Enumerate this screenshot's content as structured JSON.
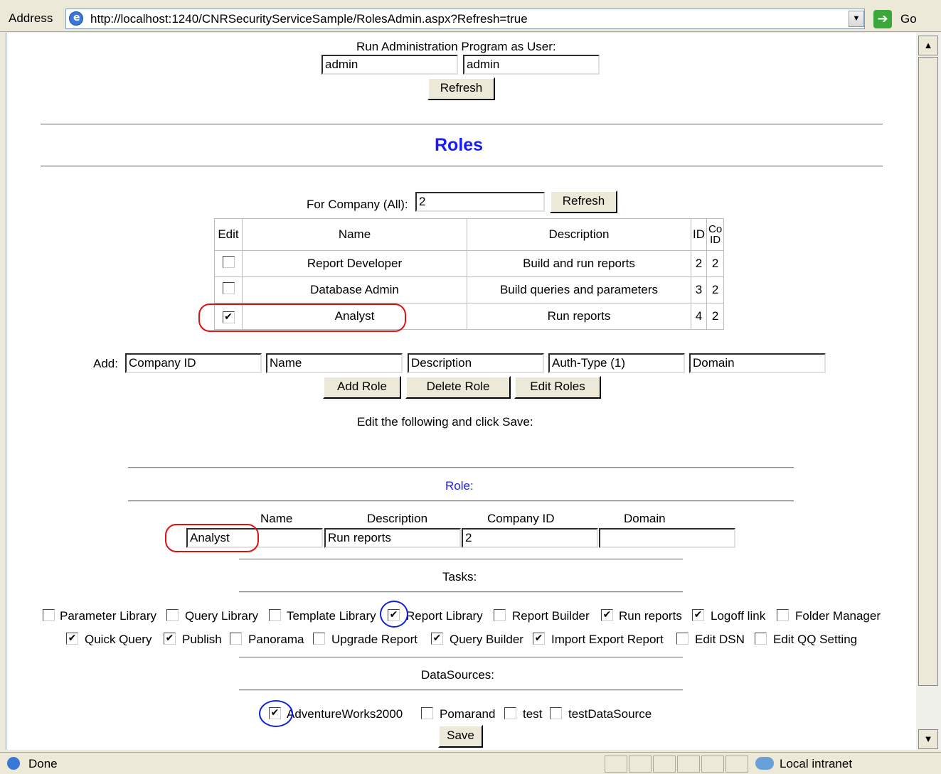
{
  "address_bar": {
    "label": "Address",
    "url": "http://localhost:1240/CNRSecurityServiceSample/RolesAdmin.aspx?Refresh=true",
    "go_label": "Go"
  },
  "run_as": {
    "title": "Run Administration Program as User:",
    "user1": "admin",
    "user2": "admin",
    "refresh_label": "Refresh"
  },
  "roles_heading": "Roles",
  "company_filter": {
    "label": "For Company (All):",
    "value": "2",
    "refresh_label": "Refresh"
  },
  "roles_table": {
    "headers": {
      "edit": "Edit",
      "name": "Name",
      "description": "Description",
      "id": "ID",
      "coid": "Co ID"
    },
    "rows": [
      {
        "checked": false,
        "name": "Report Developer",
        "description": "Build and run reports",
        "id": "2",
        "coid": "2"
      },
      {
        "checked": false,
        "name": "Database Admin",
        "description": "Build queries and parameters",
        "id": "3",
        "coid": "2"
      },
      {
        "checked": true,
        "name": "Analyst",
        "description": "Run reports",
        "id": "4",
        "coid": "2"
      }
    ]
  },
  "add_section": {
    "label": "Add:",
    "fields": [
      "Company ID",
      "Name",
      "Description",
      "Auth-Type (1)",
      "Domain"
    ],
    "add_role": "Add Role",
    "delete_role": "Delete Role",
    "edit_roles": "Edit Roles",
    "instruction": "Edit the following and click Save:"
  },
  "role_edit": {
    "title": "Role:",
    "headers": {
      "name": "Name",
      "description": "Description",
      "company_id": "Company ID",
      "domain": "Domain"
    },
    "values": {
      "name": "Analyst",
      "description": "Run reports",
      "company_id": "2",
      "domain": ""
    }
  },
  "tasks": {
    "title": "Tasks:",
    "row1": [
      {
        "label": "Parameter Library",
        "checked": false
      },
      {
        "label": "Query Library",
        "checked": false
      },
      {
        "label": "Template Library",
        "checked": false
      },
      {
        "label": "Report Library",
        "checked": true
      },
      {
        "label": "Report Builder",
        "checked": false
      },
      {
        "label": "Run reports",
        "checked": true
      },
      {
        "label": "Logoff link",
        "checked": true
      },
      {
        "label": "Folder Manager",
        "checked": false
      }
    ],
    "row2": [
      {
        "label": "Quick Query",
        "checked": true
      },
      {
        "label": "Publish",
        "checked": true
      },
      {
        "label": "Panorama",
        "checked": false
      },
      {
        "label": "Upgrade Report",
        "checked": false
      },
      {
        "label": "Query Builder",
        "checked": true
      },
      {
        "label": "Import Export Report",
        "checked": true
      },
      {
        "label": "Edit DSN",
        "checked": false
      },
      {
        "label": "Edit QQ Setting",
        "checked": false
      }
    ]
  },
  "datasources": {
    "title": "DataSources:",
    "items": [
      {
        "label": "AdventureWorks2000",
        "checked": true
      },
      {
        "label": "Pomarand",
        "checked": false
      },
      {
        "label": "test",
        "checked": false
      },
      {
        "label": "testDataSource",
        "checked": false
      }
    ],
    "save_label": "Save"
  },
  "status": {
    "text": "Done",
    "zone": "Local intranet"
  },
  "colors": {
    "heading": "#1a1aff",
    "annotation_red": "#e01010",
    "annotation_blue": "#1020e0"
  }
}
